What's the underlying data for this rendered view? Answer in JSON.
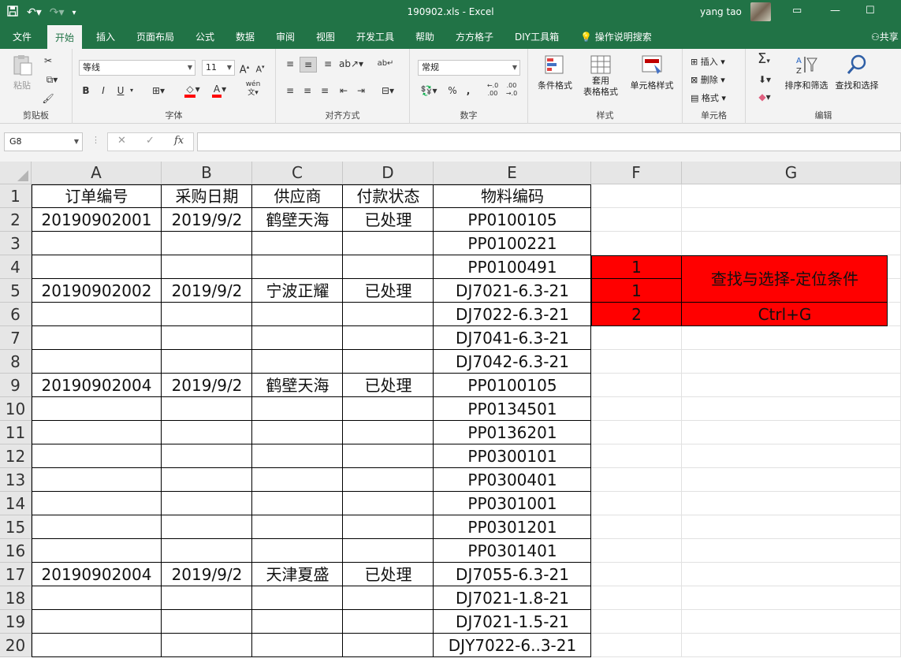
{
  "window": {
    "filename": "190902.xls",
    "separator": "-",
    "app": "Excel",
    "user": "yang tao"
  },
  "tabs": [
    "文件",
    "开始",
    "插入",
    "页面布局",
    "公式",
    "数据",
    "审阅",
    "视图",
    "开发工具",
    "帮助",
    "方方格子",
    "DIY工具箱"
  ],
  "active_tab": "开始",
  "tell_me": "操作说明搜索",
  "share": "共享",
  "ribbon": {
    "clipboard": {
      "label": "剪贴板",
      "paste": "粘贴"
    },
    "font": {
      "label": "字体",
      "name": "等线",
      "size": "11",
      "bold": "B",
      "italic": "I",
      "underline": "U",
      "phonetic": "wén"
    },
    "alignment": {
      "label": "对齐方式"
    },
    "number": {
      "label": "数字",
      "format": "常规"
    },
    "styles": {
      "label": "样式",
      "cond_format": "条件格式",
      "table_format_1": "套用",
      "table_format_2": "表格格式",
      "cell_styles": "单元格样式"
    },
    "cells": {
      "label": "单元格",
      "insert": "插入",
      "delete": "删除",
      "format": "格式"
    },
    "editing": {
      "label": "编辑",
      "sort_filter": "排序和筛选",
      "find_select": "查找和选择"
    }
  },
  "formula_bar": {
    "name_box": "G8",
    "fx": "fx",
    "value": ""
  },
  "columns": [
    "A",
    "B",
    "C",
    "D",
    "E",
    "F",
    "G"
  ],
  "rows": [
    "1",
    "2",
    "3",
    "4",
    "5",
    "6",
    "7",
    "8",
    "9",
    "10",
    "11",
    "12",
    "13",
    "14",
    "15",
    "16",
    "17",
    "18",
    "19",
    "20"
  ],
  "table": {
    "headers": [
      "订单编号",
      "采购日期",
      "供应商",
      "付款状态",
      "物料编码"
    ],
    "rows": [
      [
        "20190902001",
        "2019/9/2",
        "鹤壁天海",
        "已处理",
        "PP0100105"
      ],
      [
        "",
        "",
        "",
        "",
        "PP0100221"
      ],
      [
        "",
        "",
        "",
        "",
        "PP0100491"
      ],
      [
        "20190902002",
        "2019/9/2",
        "宁波正耀",
        "已处理",
        "DJ7021-6.3-21"
      ],
      [
        "",
        "",
        "",
        "",
        "DJ7022-6.3-21"
      ],
      [
        "",
        "",
        "",
        "",
        "DJ7041-6.3-21"
      ],
      [
        "",
        "",
        "",
        "",
        "DJ7042-6.3-21"
      ],
      [
        "20190902004",
        "2019/9/2",
        "鹤壁天海",
        "已处理",
        "PP0100105"
      ],
      [
        "",
        "",
        "",
        "",
        "PP0134501"
      ],
      [
        "",
        "",
        "",
        "",
        "PP0136201"
      ],
      [
        "",
        "",
        "",
        "",
        "PP0300101"
      ],
      [
        "",
        "",
        "",
        "",
        "PP0300401"
      ],
      [
        "",
        "",
        "",
        "",
        "PP0301001"
      ],
      [
        "",
        "",
        "",
        "",
        "PP0301201"
      ],
      [
        "",
        "",
        "",
        "",
        "PP0301401"
      ],
      [
        "20190902004",
        "2019/9/2",
        "天津夏盛",
        "已处理",
        "DJ7055-6.3-21"
      ],
      [
        "",
        "",
        "",
        "",
        "DJ7021-1.8-21"
      ],
      [
        "",
        "",
        "",
        "",
        "DJ7021-1.5-21"
      ],
      [
        "",
        "",
        "",
        "",
        "DJY7022-6..3-21"
      ]
    ]
  },
  "note_block": {
    "f_values": [
      "1",
      "1",
      "2"
    ],
    "g_merged": "查找与选择-定位条件",
    "g_shortcut": "Ctrl+G",
    "fill_color": "#ff0000"
  },
  "colors": {
    "brand": "#217346",
    "ribbon_bg": "#f3f3f3"
  }
}
